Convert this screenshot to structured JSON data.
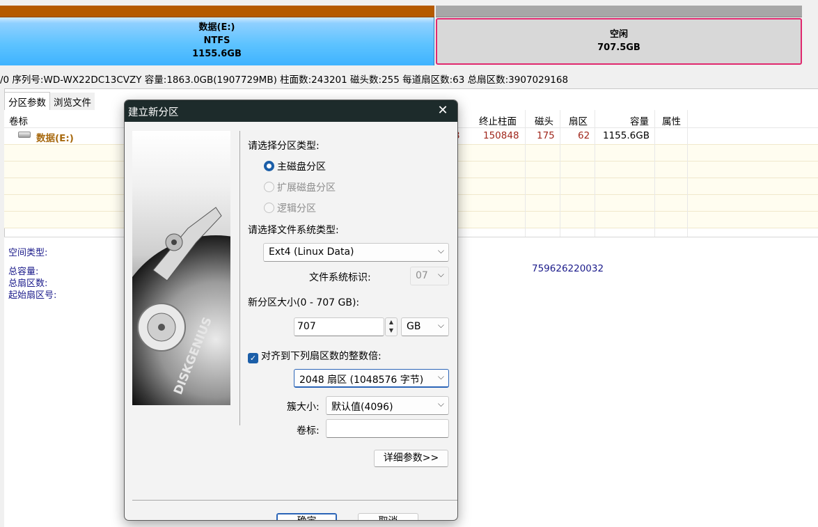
{
  "disk_map": {
    "partition_e": {
      "name": "数据(E:)",
      "fs": "NTFS",
      "size": "1155.6GB",
      "color": "#3fb3ff"
    },
    "free_space": {
      "name": "空闲",
      "size": "707.5GB",
      "border_color": "#e0286e"
    }
  },
  "disk_info": "/0  序列号:WD-WX22DC13CVZY  容量:1863.0GB(1907729MB)  柱面数:243201  磁头数:255  每道扇区数:63  总扇区数:3907029168",
  "tabs": [
    "分区参数",
    "浏览文件"
  ],
  "grid": {
    "headers": {
      "label": "卷标",
      "end_cyl": "终止柱面",
      "head": "磁头",
      "sector": "扇区",
      "capacity": "容量",
      "attr": "属性"
    },
    "row": {
      "label": "数据(E:)",
      "end_cyl": "150848",
      "head": "175",
      "sector": "62",
      "capacity": "1155.6GB",
      "partial": "3"
    }
  },
  "lower": {
    "space_type": "空间类型:",
    "total_capacity": "总容量:",
    "total_sectors": "总扇区数:",
    "start_sector": "起始扇区号:",
    "value": "759626220032"
  },
  "dialog": {
    "title": "建立新分区",
    "partition_type_label": "请选择分区类型:",
    "radios": [
      {
        "label": "主磁盘分区",
        "checked": true,
        "enabled": true
      },
      {
        "label": "扩展磁盘分区",
        "checked": false,
        "enabled": false
      },
      {
        "label": "逻辑分区",
        "checked": false,
        "enabled": false
      }
    ],
    "fs_type_label": "请选择文件系统类型:",
    "fs_type_value": "Ext4 (Linux Data)",
    "fs_id_label": "文件系统标识:",
    "fs_id_value": "07",
    "size_label": "新分区大小(0 - 707 GB):",
    "size_value": "707",
    "size_unit": "GB",
    "align_label": "对齐到下列扇区数的整数倍:",
    "align_checked": true,
    "align_value": "2048 扇区 (1048576 字节)",
    "cluster_label": "簇大小:",
    "cluster_value": "默认值(4096)",
    "volume_label": "卷标:",
    "volume_value": "",
    "details_button": "详细参数>>",
    "ok_button": "确定",
    "cancel_button": "取消",
    "hdd_brand": "DISKGENIUS"
  }
}
